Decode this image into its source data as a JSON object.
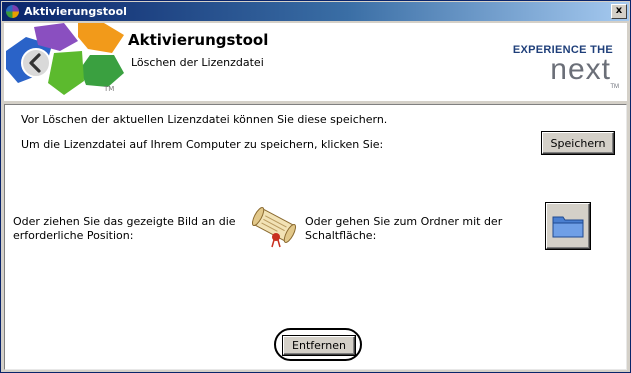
{
  "window": {
    "title": "Aktivierungstool",
    "close_label": "x"
  },
  "header": {
    "title": "Aktivierungstool",
    "subtitle": "Löschen der Lizenzdatei",
    "brand_tagline": "EXPERIENCE THE",
    "brand_name": "next",
    "brand_tm": "TM",
    "logo_tm": "TM"
  },
  "content": {
    "line1": "Vor Löschen der aktuellen Lizenzdatei können Sie diese speichern.",
    "line2": "Um die Lizenzdatei auf Ihrem Computer zu speichern, klicken Sie:",
    "save_label": "Speichern",
    "drag_text": "Oder ziehen Sie das gezeigte Bild an die erforderliche Position:",
    "folder_text": "Oder gehen Sie zum Ordner mit der Schaltfläche:",
    "remove_label": "Entfernen"
  },
  "colors": {
    "titlebar_start": "#0a246a",
    "titlebar_end": "#a6caf0",
    "brand_blue": "#1f3f7a",
    "brand_gray": "#6b6f78",
    "folder_blue": "#4a7fd0"
  },
  "icons": [
    "app-logo-icon",
    "close-icon",
    "back-arrow-icon",
    "scroll-icon",
    "folder-icon"
  ]
}
